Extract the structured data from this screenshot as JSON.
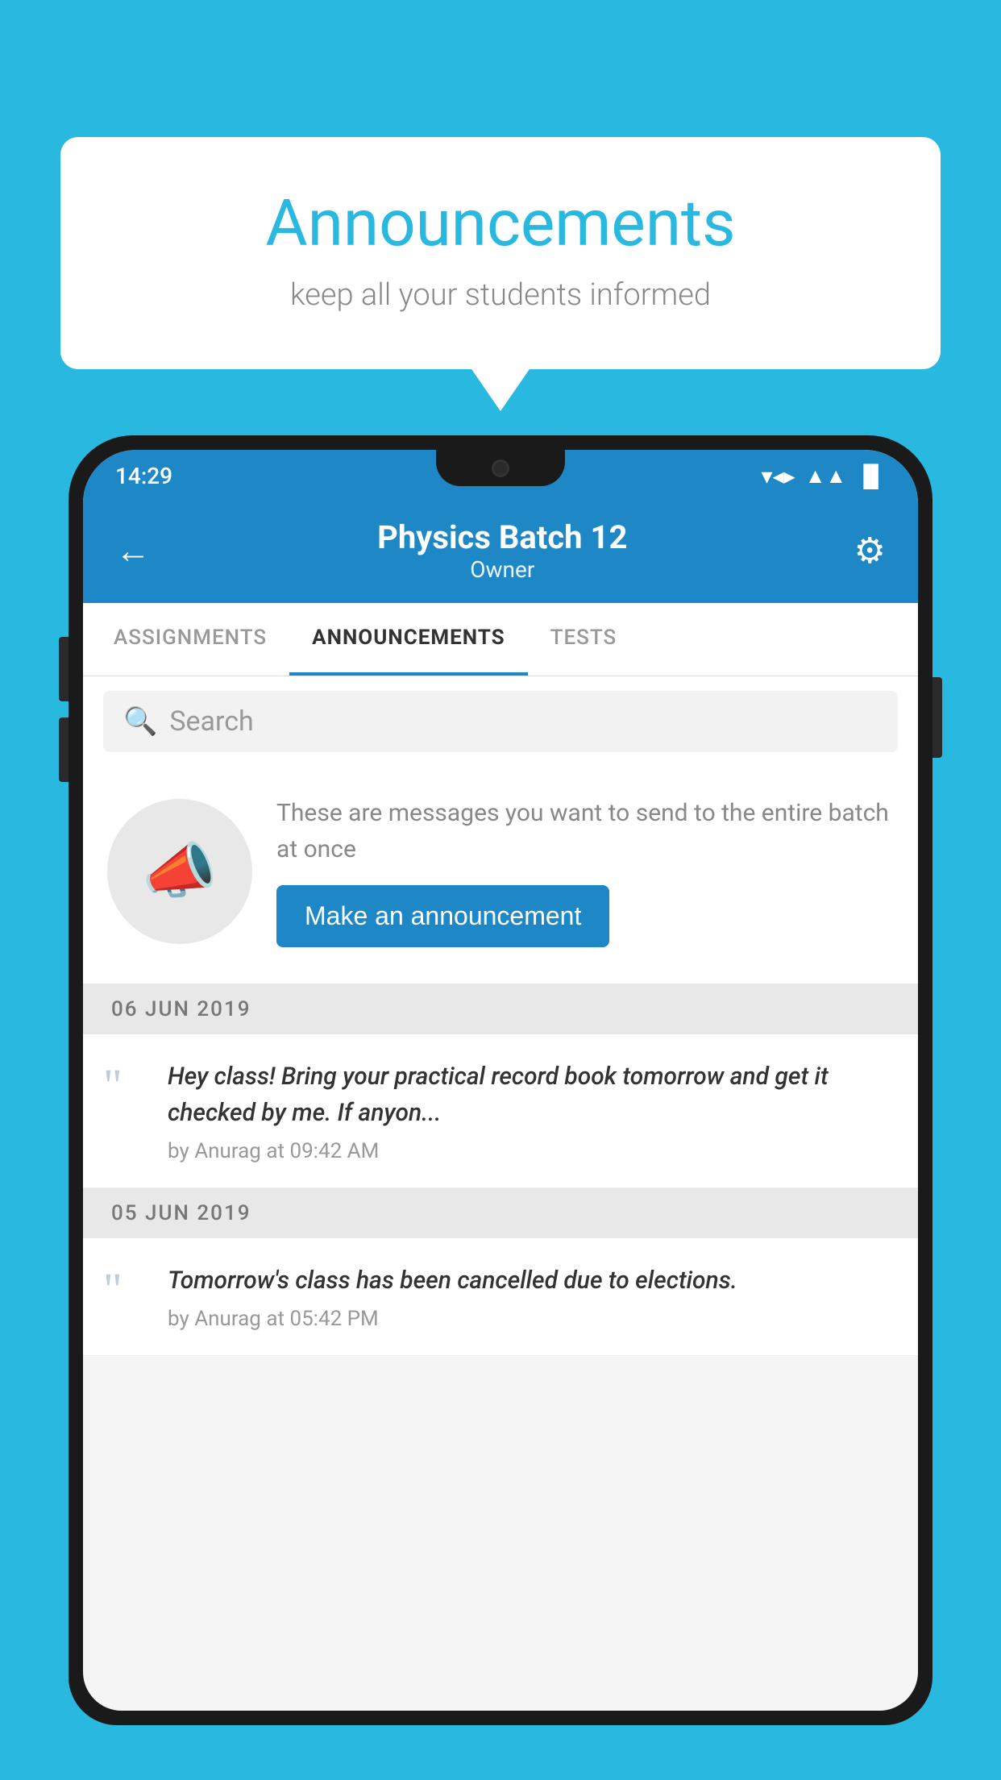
{
  "background_color": "#29b8e0",
  "speech_bubble": {
    "title": "Announcements",
    "subtitle": "keep all your students informed"
  },
  "status_bar": {
    "time": "14:29",
    "wifi": "▼",
    "signal": "▲",
    "battery": "▐"
  },
  "header": {
    "title": "Physics Batch 12",
    "subtitle": "Owner",
    "back_label": "←",
    "gear_label": "⚙"
  },
  "tabs": [
    {
      "label": "ASSIGNMENTS",
      "active": false
    },
    {
      "label": "ANNOUNCEMENTS",
      "active": true
    },
    {
      "label": "TESTS",
      "active": false
    }
  ],
  "search": {
    "placeholder": "Search"
  },
  "promo_section": {
    "description": "These are messages you want to send to the entire batch at once",
    "button_label": "Make an announcement"
  },
  "announcements": [
    {
      "date": "06  JUN  2019",
      "text": "Hey class! Bring your practical record book tomorrow and get it checked by me. If anyon...",
      "meta": "by Anurag at 09:42 AM"
    },
    {
      "date": "05  JUN  2019",
      "text": "Tomorrow's class has been cancelled due to elections.",
      "meta": "by Anurag at 05:42 PM"
    }
  ]
}
